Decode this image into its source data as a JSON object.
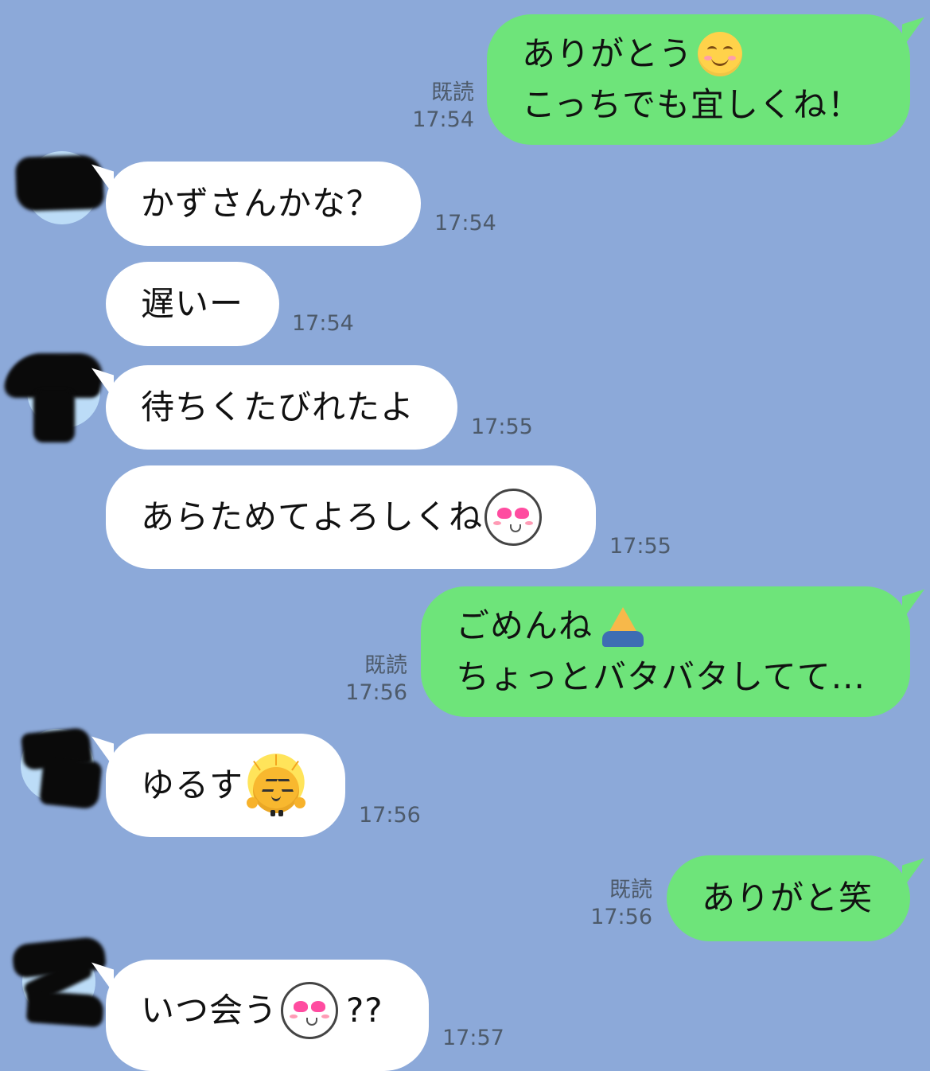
{
  "messages": [
    {
      "id": "m1",
      "direction": "out",
      "read": "既読",
      "time": "17:54",
      "lines": [
        {
          "text": "ありがとう",
          "emoji": "smile-icon"
        },
        {
          "text": "こっちでも宜しくね！"
        }
      ]
    },
    {
      "id": "m2",
      "direction": "in",
      "time": "17:54",
      "lines": [
        {
          "text": "かずさんかな？"
        }
      ]
    },
    {
      "id": "m3",
      "direction": "in",
      "time": "17:54",
      "lines": [
        {
          "text": "遅いー"
        }
      ]
    },
    {
      "id": "m4",
      "direction": "in",
      "time": "17:55",
      "lines": [
        {
          "text": "待ちくたびれたよ"
        }
      ]
    },
    {
      "id": "m5",
      "direction": "in",
      "time": "17:55",
      "lines": [
        {
          "text": "あらためてよろしくね",
          "emoji": "love-icon"
        }
      ]
    },
    {
      "id": "m6",
      "direction": "out",
      "read": "既読",
      "time": "17:56",
      "lines": [
        {
          "text": "ごめんね",
          "emoji": "pray-icon"
        },
        {
          "text": "ちょっとバタバタしてて..."
        }
      ]
    },
    {
      "id": "m7",
      "direction": "in",
      "time": "17:56",
      "lines": [
        {
          "text": "ゆるす",
          "emoji": "shine-icon"
        }
      ]
    },
    {
      "id": "m8",
      "direction": "out",
      "read": "既読",
      "time": "17:56",
      "lines": [
        {
          "text": "ありがと笑"
        }
      ]
    },
    {
      "id": "m9",
      "direction": "in",
      "time": "17:57",
      "lines": [
        {
          "text": "いつ会う",
          "emoji": "love-icon",
          "suffix": "??"
        }
      ]
    }
  ],
  "colors": {
    "background": "#8ca9d9",
    "incoming_bubble": "#ffffff",
    "outgoing_bubble": "#6ee47a",
    "meta_text": "#4d5a6a"
  }
}
